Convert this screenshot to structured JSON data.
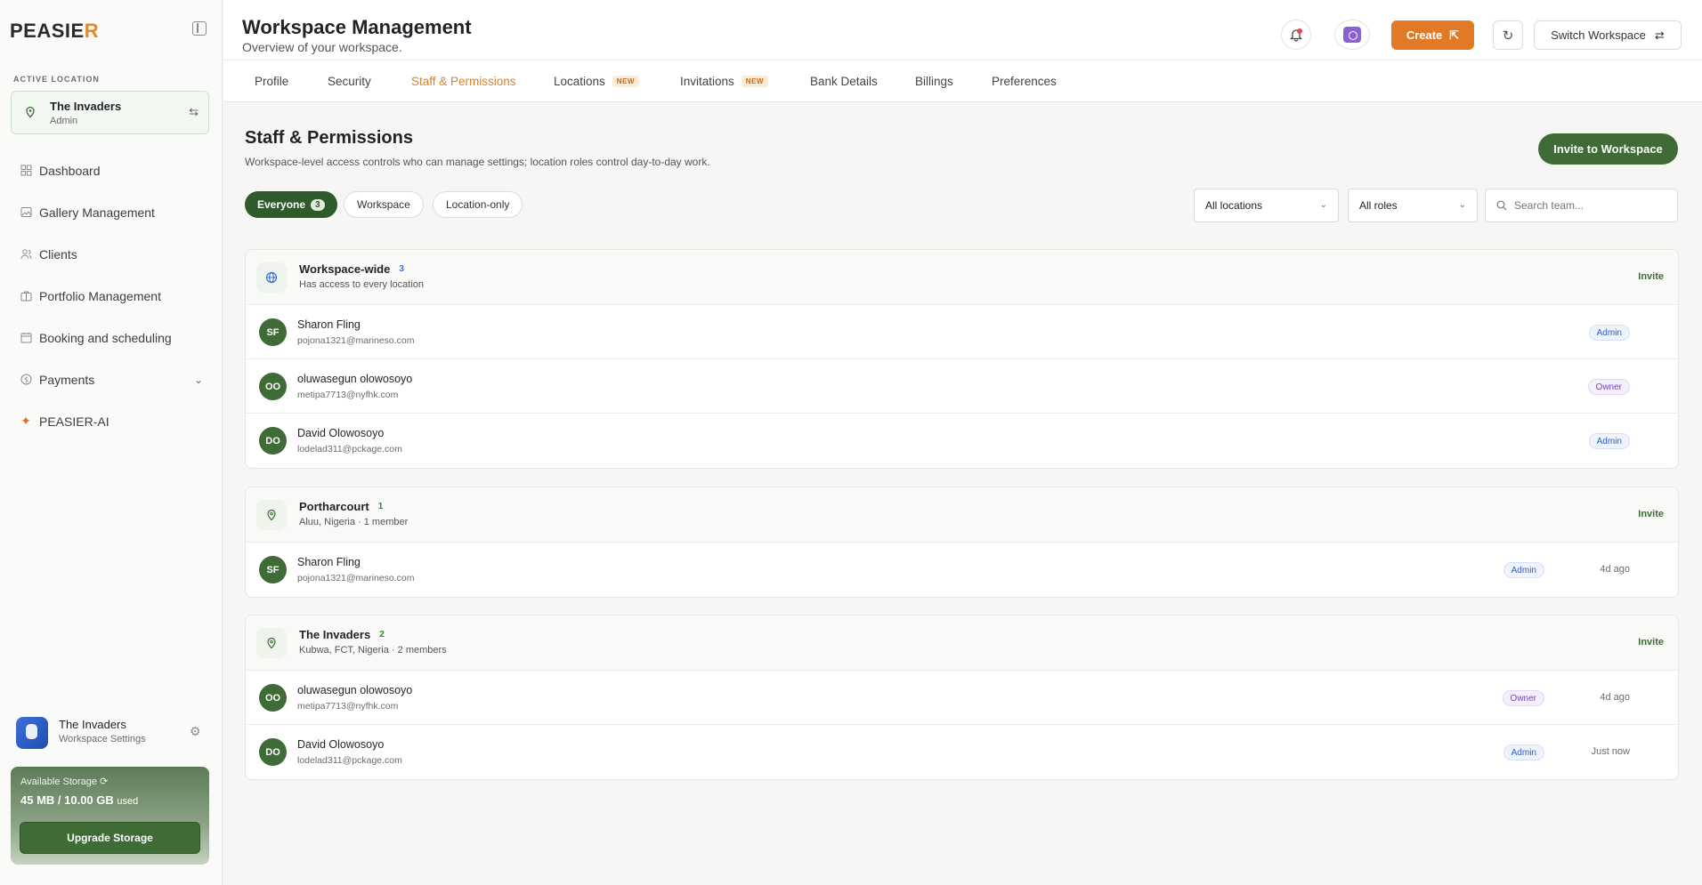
{
  "brand": {
    "logo_main": "PEASIE",
    "logo_accent": "R"
  },
  "sidebar": {
    "active_label": "ACTIVE LOCATION",
    "active_location": {
      "name": "The Invaders",
      "role": "Admin"
    },
    "items": [
      {
        "label": "Dashboard",
        "icon": "dashboard-icon"
      },
      {
        "label": "Gallery Management",
        "icon": "gallery-icon"
      },
      {
        "label": "Clients",
        "icon": "users-icon"
      },
      {
        "label": "Portfolio Management",
        "icon": "portfolio-icon"
      },
      {
        "label": "Booking and scheduling",
        "icon": "calendar-icon"
      },
      {
        "label": "Payments",
        "icon": "dollar-icon"
      },
      {
        "label": "PEASIER-AI",
        "icon": "sparkle-icon"
      }
    ],
    "workspace": {
      "name": "The Invaders",
      "sub": "Workspace Settings"
    },
    "storage": {
      "label": "Available Storage",
      "used": "45 MB / 10.00 GB",
      "used_suffix": "used",
      "upgrade": "Upgrade Storage"
    }
  },
  "header": {
    "title": "Workspace Management",
    "subtitle": "Overview of your workspace.",
    "create": "Create",
    "switch": "Switch Workspace"
  },
  "tabs": [
    {
      "label": "Profile"
    },
    {
      "label": "Security"
    },
    {
      "label": "Staff & Permissions",
      "active": true
    },
    {
      "label": "Locations",
      "badge": "NEW"
    },
    {
      "label": "Invitations",
      "badge": "NEW"
    },
    {
      "label": "Bank Details"
    },
    {
      "label": "Billings"
    },
    {
      "label": "Preferences"
    }
  ],
  "main": {
    "title": "Staff & Permissions",
    "description": "Workspace-level access controls who can manage settings; location roles control day-to-day work.",
    "invite_button": "Invite to Workspace",
    "filters": {
      "everyone": "Everyone",
      "everyone_count": "3",
      "workspace": "Workspace",
      "location_only": "Location-only"
    },
    "location_select": "All locations",
    "role_select": "All roles",
    "search_placeholder": "Search team...",
    "invite_link": "Invite"
  },
  "groups": [
    {
      "name": "Workspace-wide",
      "count": "3",
      "sub": "Has access to every location",
      "members": [
        {
          "initials": "SF",
          "name": "Sharon Fling",
          "email": "pojona1321@marineso.com",
          "role": "Admin",
          "time": ""
        },
        {
          "initials": "OO",
          "name": "oluwasegun olowosoyo",
          "email": "metipa7713@nyfhk.com",
          "role": "Owner",
          "time": ""
        },
        {
          "initials": "DO",
          "name": "David Olowosoyo",
          "email": "lodelad311@pckage.com",
          "role": "Admin",
          "time": ""
        }
      ]
    },
    {
      "name": "Portharcourt",
      "count": "1",
      "sub": "Aluu, Nigeria · 1 member",
      "members": [
        {
          "initials": "SF",
          "name": "Sharon Fling",
          "email": "pojona1321@marineso.com",
          "role": "Admin",
          "time": "4d ago"
        }
      ]
    },
    {
      "name": "The Invaders",
      "count": "2",
      "sub": "Kubwa, FCT, Nigeria · 2 members",
      "members": [
        {
          "initials": "OO",
          "name": "oluwasegun olowosoyo",
          "email": "metipa7713@nyfhk.com",
          "role": "Owner",
          "time": "4d ago"
        },
        {
          "initials": "DO",
          "name": "David Olowosoyo",
          "email": "lodelad311@pckage.com",
          "role": "Admin",
          "time": "Just now"
        }
      ]
    }
  ],
  "colors": {
    "brand_green": "#3f6b37",
    "accent_orange": "#e07a26",
    "admin_blue": "#2d5fc0",
    "owner_purple": "#7b3fc4"
  }
}
